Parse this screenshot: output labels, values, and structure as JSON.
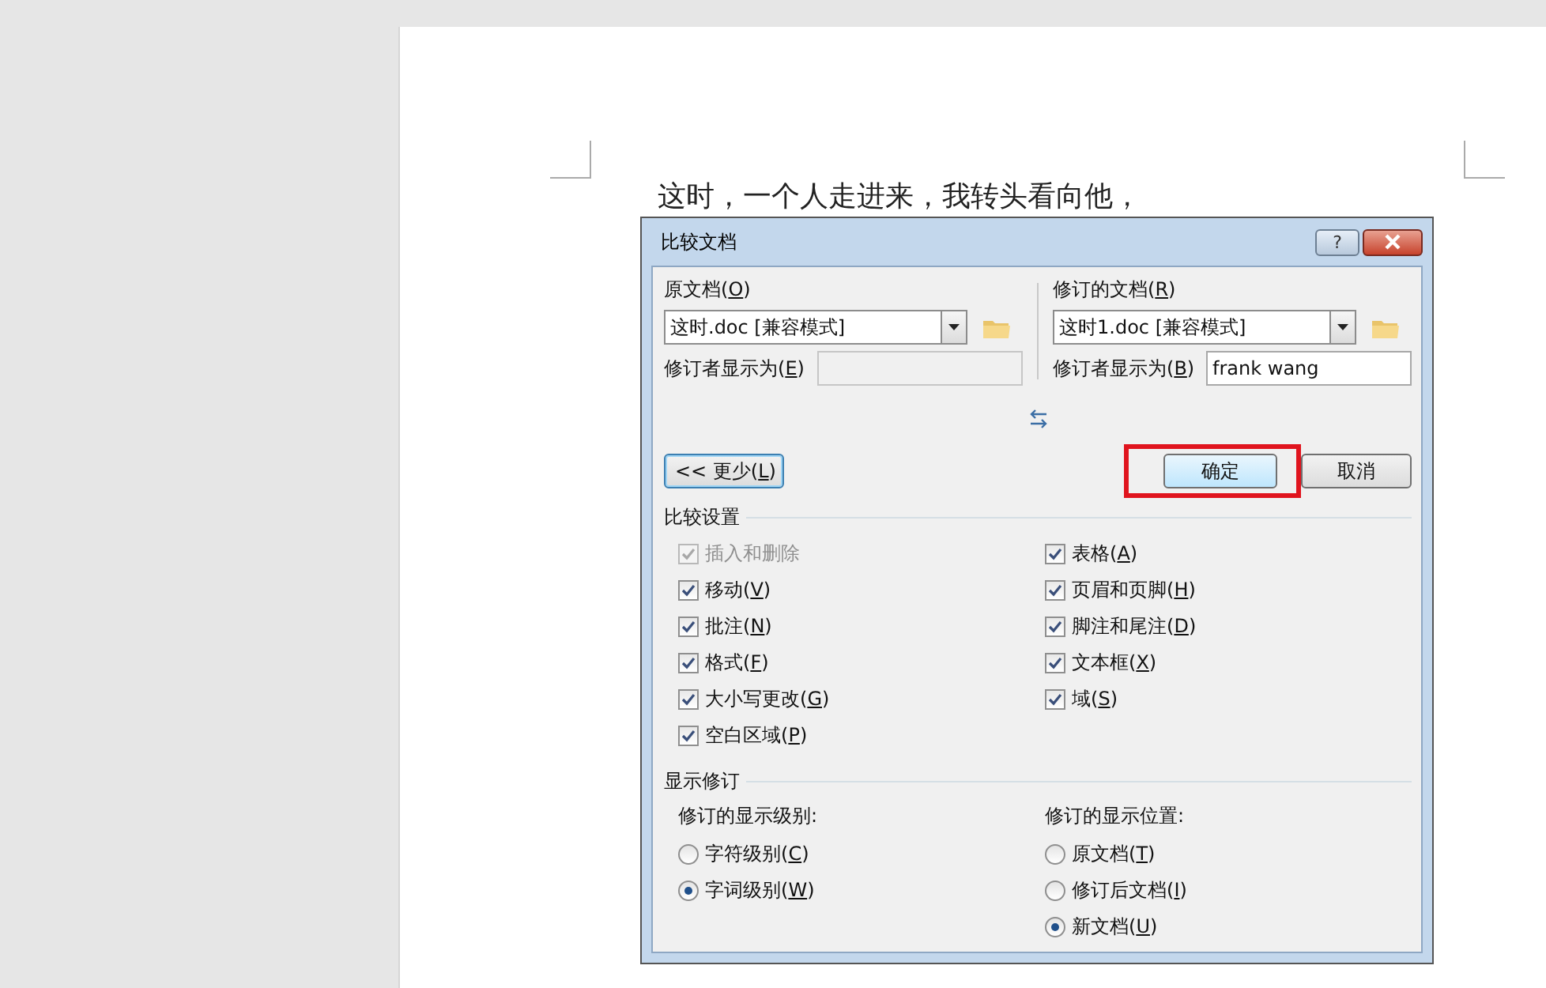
{
  "document": {
    "text": "这时，一个人走进来，我转头看向他，"
  },
  "dialog": {
    "title": "比较文档",
    "help_button": {
      "label": "?"
    },
    "sources": [
      {
        "label": {
          "text": "原文档(",
          "key": "O",
          "tail": ")"
        },
        "file": "这时.doc [兼容模式]",
        "author_label": {
          "text": "修订者显示为(",
          "key": "E",
          "tail": ")"
        },
        "author": {
          "disabled": true
        }
      },
      {
        "label": {
          "text": "修订的文档(",
          "key": "R",
          "tail": ")"
        },
        "file": "这时1.doc [兼容模式]",
        "author_label": {
          "text": "修订者显示为(",
          "key": "B",
          "tail": ")"
        },
        "author": {
          "value": "frank wang",
          "disabled": false
        }
      }
    ],
    "buttons": [
      {
        "kind": "more",
        "label": {
          "text": "<< 更少(",
          "key": "L",
          "tail": ")"
        },
        "focused": true,
        "highlighted": false
      },
      {
        "kind": "ok",
        "label": {
          "text": "确定"
        },
        "focused": false,
        "highlighted": true
      },
      {
        "kind": "cancel",
        "label": {
          "text": "取消"
        },
        "focused": false,
        "highlighted": false
      }
    ],
    "compare_settings": {
      "title": "比较设置",
      "columns": [
        [
          {
            "label": {
              "text": "插入和删除"
            },
            "checked": true,
            "disabled": true
          },
          {
            "label": {
              "text": "移动(",
              "key": "V",
              "tail": ")"
            },
            "checked": true,
            "disabled": false
          },
          {
            "label": {
              "text": "批注(",
              "key": "N",
              "tail": ")"
            },
            "checked": true,
            "disabled": false
          },
          {
            "label": {
              "text": "格式(",
              "key": "F",
              "tail": ")"
            },
            "checked": true,
            "disabled": false
          },
          {
            "label": {
              "text": "大小写更改(",
              "key": "G",
              "tail": ")"
            },
            "checked": true,
            "disabled": false
          },
          {
            "label": {
              "text": "空白区域(",
              "key": "P",
              "tail": ")"
            },
            "checked": true,
            "disabled": false
          }
        ],
        [
          {
            "label": {
              "text": "表格(",
              "key": "A",
              "tail": ")"
            },
            "checked": true,
            "disabled": false
          },
          {
            "label": {
              "text": "页眉和页脚(",
              "key": "H",
              "tail": ")"
            },
            "checked": true,
            "disabled": false
          },
          {
            "label": {
              "text": "脚注和尾注(",
              "key": "D",
              "tail": ")"
            },
            "checked": true,
            "disabled": false
          },
          {
            "label": {
              "text": "文本框(",
              "key": "X",
              "tail": ")"
            },
            "checked": true,
            "disabled": false
          },
          {
            "label": {
              "text": "域(",
              "key": "S",
              "tail": ")"
            },
            "checked": true,
            "disabled": false
          }
        ]
      ]
    },
    "show_revisions": {
      "title": "显示修订",
      "groups": [
        {
          "title": "修订的显示级别:",
          "options": [
            {
              "label": {
                "text": "字符级别(",
                "key": "C",
                "tail": ")"
              },
              "selected": false
            },
            {
              "label": {
                "text": "字词级别(",
                "key": "W",
                "tail": ")"
              },
              "selected": true
            }
          ]
        },
        {
          "title": "修订的显示位置:",
          "options": [
            {
              "label": {
                "text": "原文档(",
                "key": "T",
                "tail": ")"
              },
              "selected": false
            },
            {
              "label": {
                "text": "修订后文档(",
                "key": "I",
                "tail": ")"
              },
              "selected": false
            },
            {
              "label": {
                "text": "新文档(",
                "key": "U",
                "tail": ")"
              },
              "selected": true
            }
          ]
        }
      ]
    }
  }
}
